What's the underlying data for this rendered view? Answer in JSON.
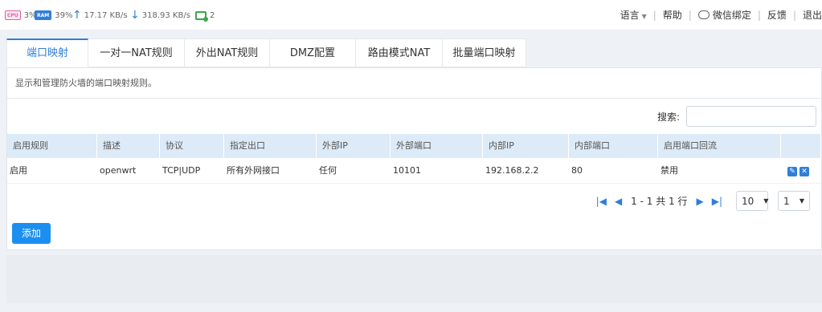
{
  "status": {
    "cpu_chip": "CPU",
    "cpu": "3%",
    "ram_chip": "RAM",
    "ram": "39%",
    "upload": "17.17 KB/s",
    "download": "318.93 KB/s",
    "devices": "2"
  },
  "nav": {
    "language": "语言",
    "help": "帮助",
    "wechat": "微信绑定",
    "feedback": "反馈",
    "logout": "退出"
  },
  "tabs": [
    {
      "label": "端口映射"
    },
    {
      "label": "一对一NAT规则"
    },
    {
      "label": "外出NAT规则"
    },
    {
      "label": "DMZ配置"
    },
    {
      "label": "路由模式NAT"
    },
    {
      "label": "批量端口映射"
    }
  ],
  "panel": {
    "description": "显示和管理防火墙的端口映射规则。",
    "search_label": "搜索:",
    "search_value": ""
  },
  "table": {
    "headers": [
      "启用规则",
      "描述",
      "协议",
      "指定出口",
      "外部IP",
      "外部端口",
      "内部IP",
      "内部端口",
      "启用端口回流",
      ""
    ],
    "rows": [
      [
        "启用",
        "openwrt",
        "TCP|UDP",
        "所有外网接口",
        "任何",
        "10101",
        "192.168.2.2",
        "80",
        "禁用"
      ]
    ]
  },
  "pager": {
    "summary": "1 - 1 共 1 行",
    "page_size": "10",
    "page": "1"
  },
  "actions": {
    "add": "添加"
  },
  "colors": {
    "accent": "#2f7fd8",
    "button": "#1b8ff0",
    "header_bg": "#ddeaf7"
  }
}
